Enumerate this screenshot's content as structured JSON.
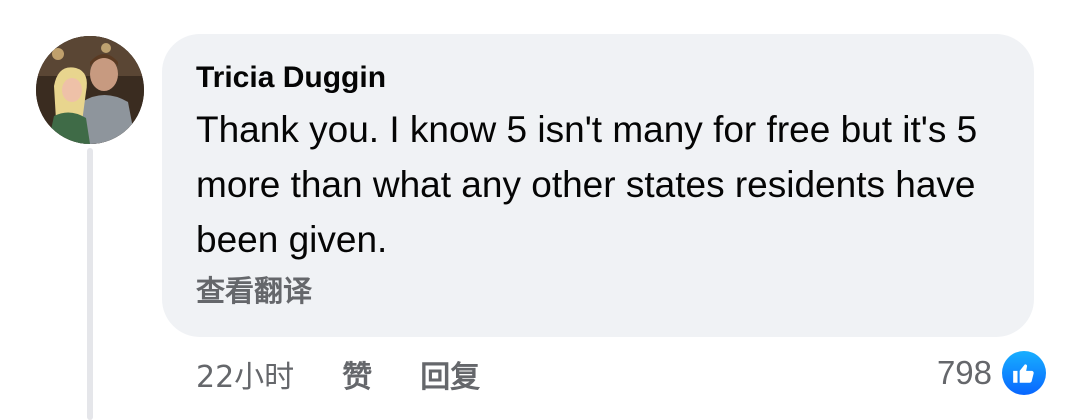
{
  "comment": {
    "author": "Tricia Duggin",
    "text": "Thank you. I know 5 isn't many for free but it's 5 more than what any other states residents have been given.",
    "translate_label": "查看翻译",
    "avatar_icon": "profile-photo-avatar"
  },
  "actions": {
    "timestamp": "22小时",
    "like_label": "赞",
    "reply_label": "回复"
  },
  "reactions": {
    "count": "798",
    "icon": "like-thumbs-up-icon",
    "color": "#0866ff"
  },
  "colors": {
    "bubble": "#f0f2f5",
    "secondary_text": "#65676b",
    "primary_text": "#050505"
  }
}
